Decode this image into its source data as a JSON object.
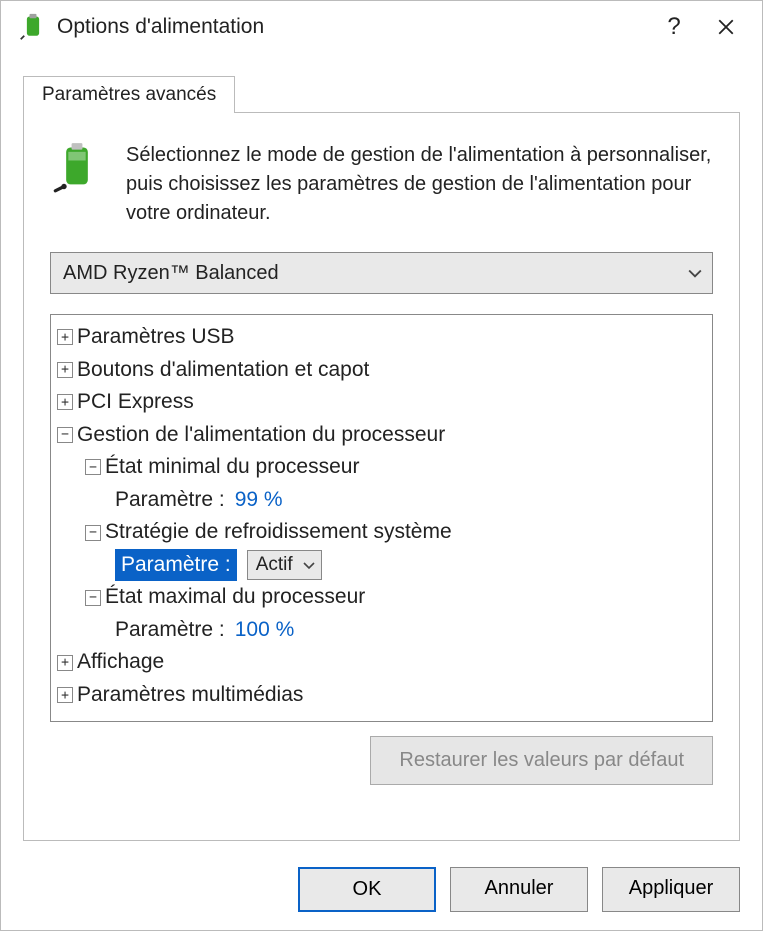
{
  "window": {
    "title": "Options d'alimentation",
    "help_label": "?",
    "close_label": "✕"
  },
  "tab": {
    "label": "Paramètres avancés"
  },
  "intro": {
    "text": "Sélectionnez le mode de gestion de l'alimentation à personnaliser, puis choisissez les paramètres de gestion de l'alimentation pour votre ordinateur."
  },
  "plan": {
    "selected": "AMD Ryzen™ Balanced"
  },
  "tree": {
    "n0": {
      "exp": "+",
      "label": "Paramètres USB"
    },
    "n1": {
      "exp": "+",
      "label": "Boutons d'alimentation et capot"
    },
    "n2": {
      "exp": "+",
      "label": "PCI Express"
    },
    "n3": {
      "exp": "−",
      "label": "Gestion de l'alimentation du processeur"
    },
    "n3a": {
      "exp": "−",
      "label": "État minimal du processeur"
    },
    "n3a_p": {
      "label": "Paramètre :",
      "value": "99  %"
    },
    "n3b": {
      "exp": "−",
      "label": "Stratégie de refroidissement système"
    },
    "n3b_p": {
      "label": "Paramètre :",
      "value": "Actif"
    },
    "n3c": {
      "exp": "−",
      "label": "État maximal du processeur"
    },
    "n3c_p": {
      "label": "Paramètre :",
      "value": "100  %"
    },
    "n4": {
      "exp": "+",
      "label": "Affichage"
    },
    "n5": {
      "exp": "+",
      "label": "Paramètres multimédias"
    }
  },
  "buttons": {
    "restore": "Restaurer les valeurs par défaut",
    "ok": "OK",
    "cancel": "Annuler",
    "apply": "Appliquer"
  }
}
